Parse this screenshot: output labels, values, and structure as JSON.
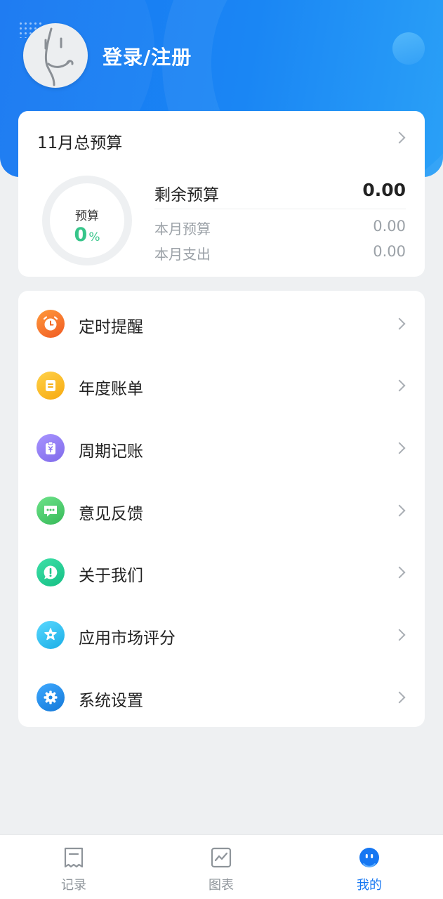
{
  "header": {
    "login_label": "登录/注册"
  },
  "budget": {
    "title": "11月总预算",
    "ring_label": "预算",
    "ring_percent": "0",
    "ring_percent_unit": "%",
    "remaining_label": "剩余预算",
    "remaining_value": "0.00",
    "month_budget_label": "本月预算",
    "month_budget_value": "0.00",
    "month_expense_label": "本月支出",
    "month_expense_value": "0.00"
  },
  "menu": {
    "items": [
      {
        "label": "定时提醒",
        "icon": "alarm-clock-icon",
        "color": "#f4782a"
      },
      {
        "label": "年度账单",
        "icon": "bill-icon",
        "color": "#f7b91b"
      },
      {
        "label": "周期记账",
        "icon": "clipboard-yuan-icon",
        "color": "#8f7cf3"
      },
      {
        "label": "意见反馈",
        "icon": "chat-bubble-icon",
        "color": "#4cc866"
      },
      {
        "label": "关于我们",
        "icon": "exclamation-icon",
        "color": "#26cf95"
      },
      {
        "label": "应用市场评分",
        "icon": "star-icon",
        "color": "#2fc4ef"
      },
      {
        "label": "系统设置",
        "icon": "gear-icon",
        "color": "#1f8de8"
      }
    ]
  },
  "tabbar": {
    "tabs": [
      {
        "label": "记录",
        "icon": "receipt-icon"
      },
      {
        "label": "图表",
        "icon": "chart-icon"
      },
      {
        "label": "我的",
        "icon": "smiley-face-icon"
      }
    ],
    "active_color": "#1677f2"
  }
}
